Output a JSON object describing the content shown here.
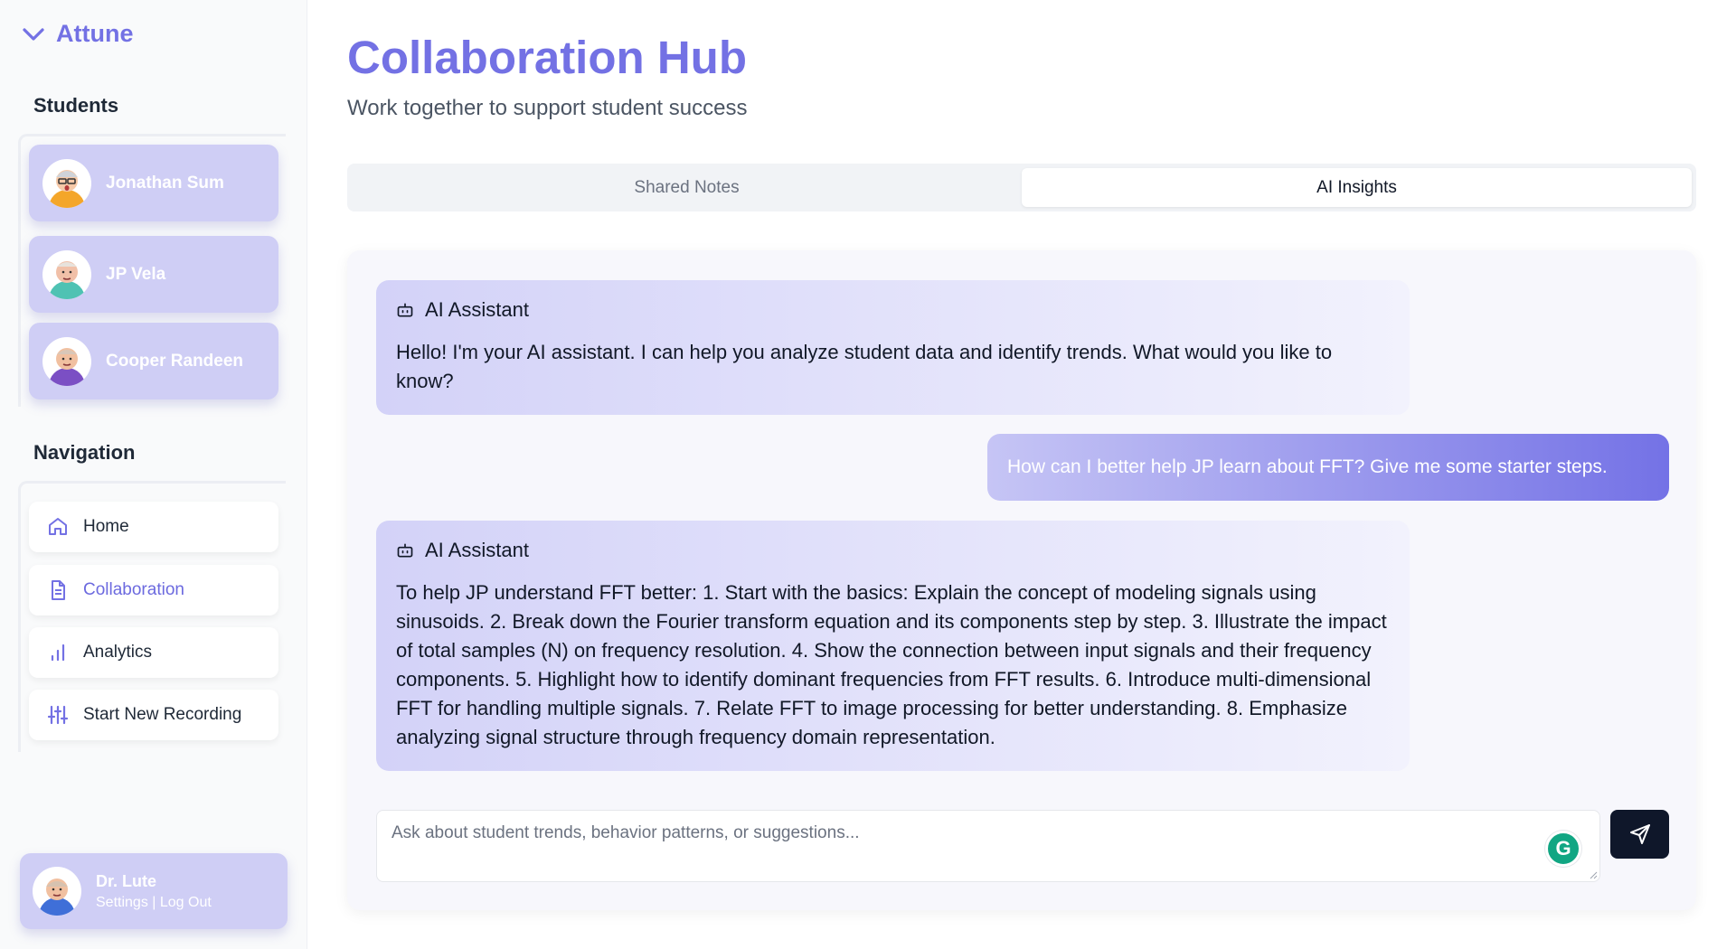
{
  "app": {
    "name": "Attune"
  },
  "sidebar": {
    "students_title": "Students",
    "students": [
      {
        "name": "Jonathan Sum"
      },
      {
        "name": "JP Vela"
      },
      {
        "name": "Cooper Randeen"
      }
    ],
    "navigation_title": "Navigation",
    "nav_items": [
      {
        "label": "Home",
        "icon": "home-icon"
      },
      {
        "label": "Collaboration",
        "icon": "document-icon",
        "active": true
      },
      {
        "label": "Analytics",
        "icon": "bar-chart-icon"
      },
      {
        "label": "Start New Recording",
        "icon": "sliders-icon"
      }
    ],
    "user": {
      "name": "Dr. Lute",
      "settings_label": "Settings",
      "separator": "|",
      "logout_label": "Log Out"
    }
  },
  "header": {
    "title": "Collaboration Hub",
    "subtitle": "Work together to support student success"
  },
  "tabs": [
    {
      "label": "Shared Notes",
      "active": false
    },
    {
      "label": "AI Insights",
      "active": true
    }
  ],
  "chat": {
    "messages": [
      {
        "role": "assistant",
        "sender": "AI Assistant",
        "text": "Hello! I'm your AI assistant. I can help you analyze student data and identify trends. What would you like to know?"
      },
      {
        "role": "user",
        "text": "How can I better help JP learn about FFT? Give me some starter steps."
      },
      {
        "role": "assistant",
        "sender": "AI Assistant",
        "text": "To help JP understand FFT better: 1. Start with the basics: Explain the concept of modeling signals using sinusoids. 2. Break down the Fourier transform equation and its components step by step. 3. Illustrate the impact of total samples (N) on frequency resolution. 4. Show the connection between input signals and their frequency components. 5. Highlight how to identify dominant frequencies from FFT results. 6. Introduce multi-dimensional FFT for handling multiple signals. 7. Relate FFT to image processing for better understanding. 8. Emphasize analyzing signal structure through frequency domain representation."
      }
    ],
    "input_placeholder": "Ask about student trends, behavior patterns, or suggestions...",
    "grammarly_letter": "G"
  },
  "colors": {
    "accent": "#7371e4",
    "card": "#cfcef5",
    "send_button": "#0f172a"
  }
}
